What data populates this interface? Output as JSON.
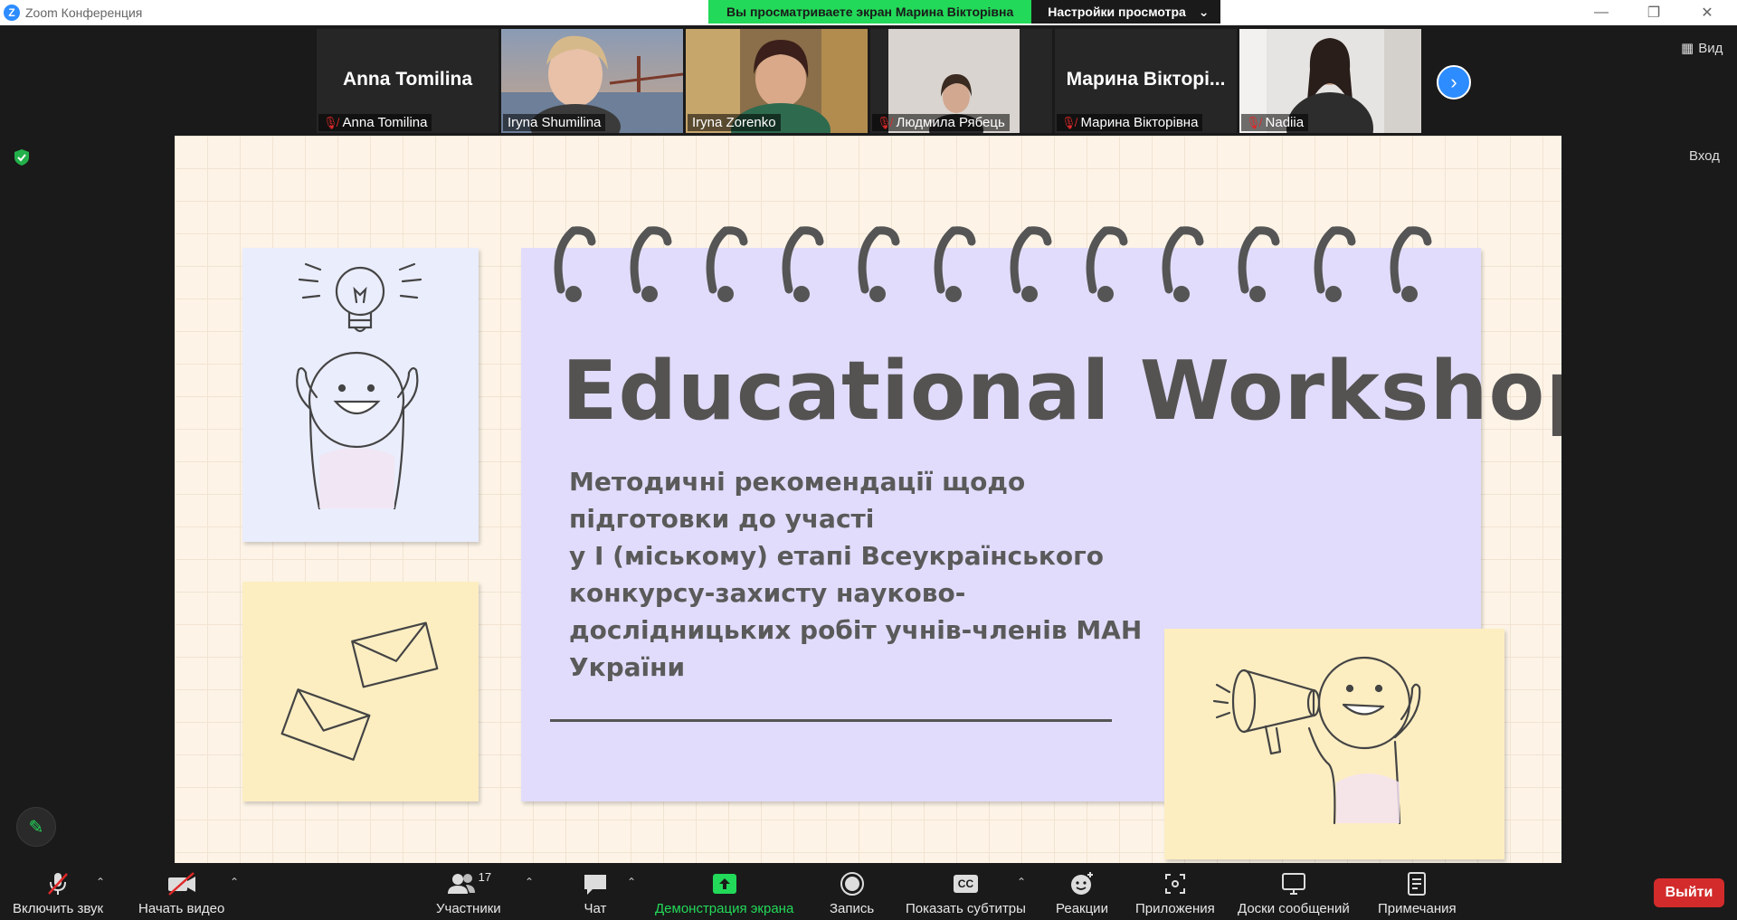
{
  "window": {
    "title": "Zoom Конференция",
    "logo_letter": "Z",
    "minimize_glyph": "—",
    "restore_glyph": "❐",
    "close_glyph": "✕"
  },
  "share_banner": {
    "viewing_text": "Вы просматриваете экран Марина Вікторівна",
    "view_options": "Настройки просмотра",
    "chevron": "⌄"
  },
  "participants": [
    {
      "big_name": "Anna Tomilina",
      "name": "Anna Tomilina",
      "muted": true,
      "has_video": false
    },
    {
      "name": "Iryna Shumilina",
      "muted": false,
      "has_video": true,
      "active": true
    },
    {
      "name": "Iryna Zorenko",
      "muted": false,
      "has_video": true
    },
    {
      "name": "Людмила Рябець",
      "muted": true,
      "has_video": true
    },
    {
      "big_name": "Марина Вікторі...",
      "name": "Марина Вікторівна",
      "muted": true,
      "has_video": false
    },
    {
      "name": "Nadiia",
      "muted": true,
      "has_video": true
    }
  ],
  "gallery_next_glyph": "›",
  "side": {
    "view_label": "Вид",
    "signin_label": "Вход"
  },
  "slide": {
    "title": "Educational Workshop:",
    "subtitle_lines": [
      "Методичні рекомендації щодо",
      "підготовки до участі",
      "у І (міському) етапі Всеукраїнського",
      "конкурсу-захисту науково-",
      "дослідницьких робіт учнів-членів МАН",
      "України"
    ]
  },
  "toolbar": {
    "unmute": "Включить звук",
    "start_video": "Начать видео",
    "participants": "Участники",
    "participants_count": "17",
    "chat": "Чат",
    "share_screen": "Демонстрация экрана",
    "record": "Запись",
    "captions": "Показать субтитры",
    "captions_badge": "CC",
    "reactions": "Реакции",
    "apps": "Приложения",
    "whiteboards": "Доски сообщений",
    "notes": "Примечания",
    "leave": "Выйти",
    "caret": "⌃"
  },
  "colors": {
    "zoom_blue": "#2d8cff",
    "share_green": "#23d959",
    "leave_red": "#d32b2b",
    "slide_purple": "#e1dcfb",
    "slide_yellow": "#fdeec2",
    "slide_blue": "#eaedfc"
  }
}
